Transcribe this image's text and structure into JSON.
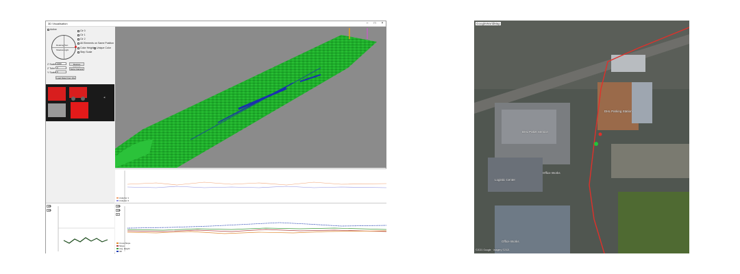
{
  "app": {
    "title": "3D Visualisation"
  },
  "controls": {
    "active_label": "Active",
    "compass_top": "Rotating Sun",
    "compass_bottom": "Shadow Light",
    "checkboxes": [
      "Cir 0",
      "Cir 1",
      "Cir 2",
      "All Elements on Same Position",
      "Color Height",
      "Unique Color",
      "Step Scale"
    ],
    "fields": [
      {
        "label": "Z Scale",
        "value": "1000"
      },
      {
        "label": "Z Tube",
        "value": "0"
      },
      {
        "label": "Y Scale",
        "value": "0"
      }
    ],
    "restore_camera": "Restore Camera",
    "store_camera": "Store Camera",
    "load_button": "Load Data From File"
  },
  "plots": {
    "upper_legend": [
      "Analyzer 1",
      "Analyzer 2"
    ],
    "lower_legend": [
      "Cross Slope",
      "Slope",
      "Avg. Height",
      "IRI"
    ],
    "lower_yvals": [
      "200",
      "100",
      "0"
    ]
  },
  "map": {
    "header": "GoogleWorldMap",
    "footer": "©2021 Google · Imagery ©2021",
    "labels": [
      "DHL Parking Station",
      "DHL Paket Service",
      "Office Works",
      "Logistic Center",
      "Office Works"
    ]
  },
  "colors": {
    "terrain": "#1fae2b",
    "route": "#e0302a",
    "marker_green": "#22c43a"
  }
}
